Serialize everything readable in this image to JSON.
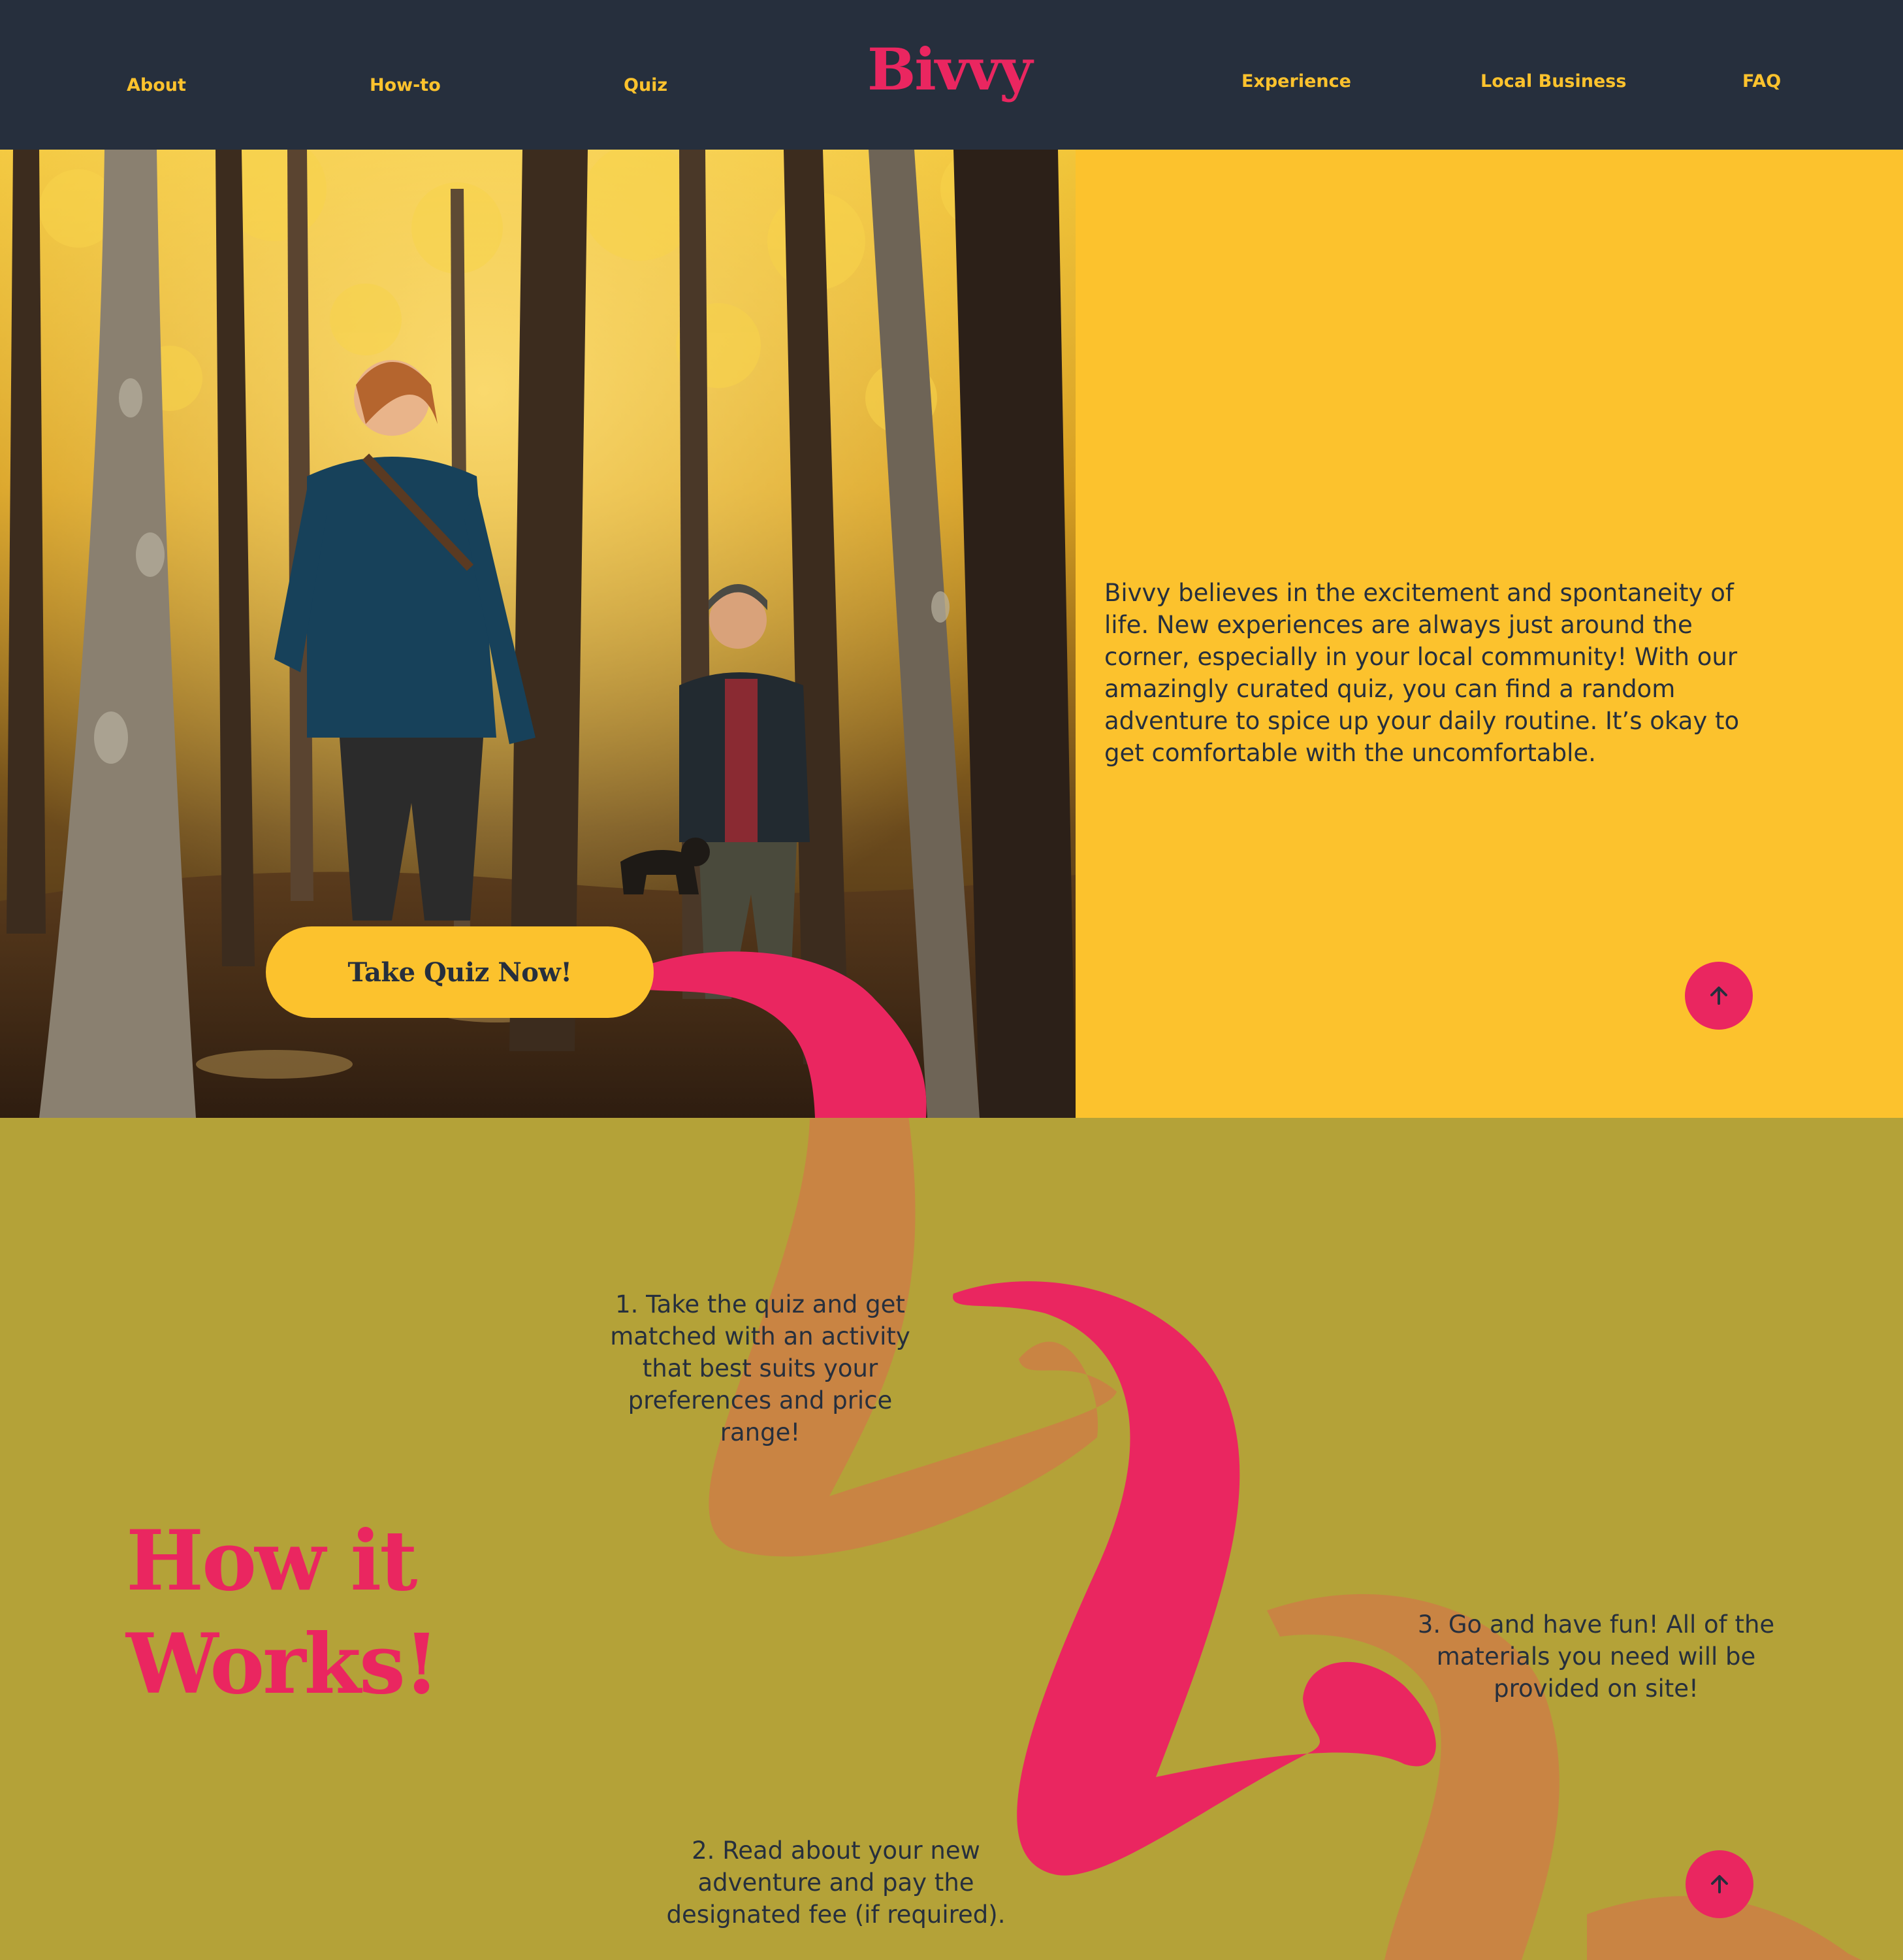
{
  "nav": {
    "left": [
      "About",
      "How-to",
      "Quiz"
    ],
    "logo": "Bivvy",
    "right": [
      "Experience",
      "Local Business",
      "FAQ"
    ]
  },
  "hero": {
    "description": "Bivvy believes in the excitement and spontaneity of life. New experiences are always just around the corner, especially in your local community! With our amazingly curated quiz, you can find a random adventure to spice up your daily routine. It’s okay to get comfortable with the uncomfortable.",
    "cta_label": "Take Quiz Now!",
    "scroll_top_icon": "arrow-up-icon"
  },
  "how_it_works": {
    "title_line1": "How it",
    "title_line2": "Works!",
    "steps": [
      "1. Take the quiz and get matched with an activity that best suits your preferences and price range!",
      "2. Read about your new adventure and pay the designated fee (if required).",
      "3. Go and have fun! All of the materials you need will be provided on site!"
    ],
    "scroll_top_icon": "arrow-up-icon"
  },
  "colors": {
    "header_bg": "#262f3d",
    "nav_text": "#fcc22d",
    "brand_pink": "#ea2660",
    "hero_panel": "#fcc22d",
    "section_olive": "#b4a238",
    "swoosh_faded": "#c98443",
    "text_dark": "#262f3d"
  }
}
